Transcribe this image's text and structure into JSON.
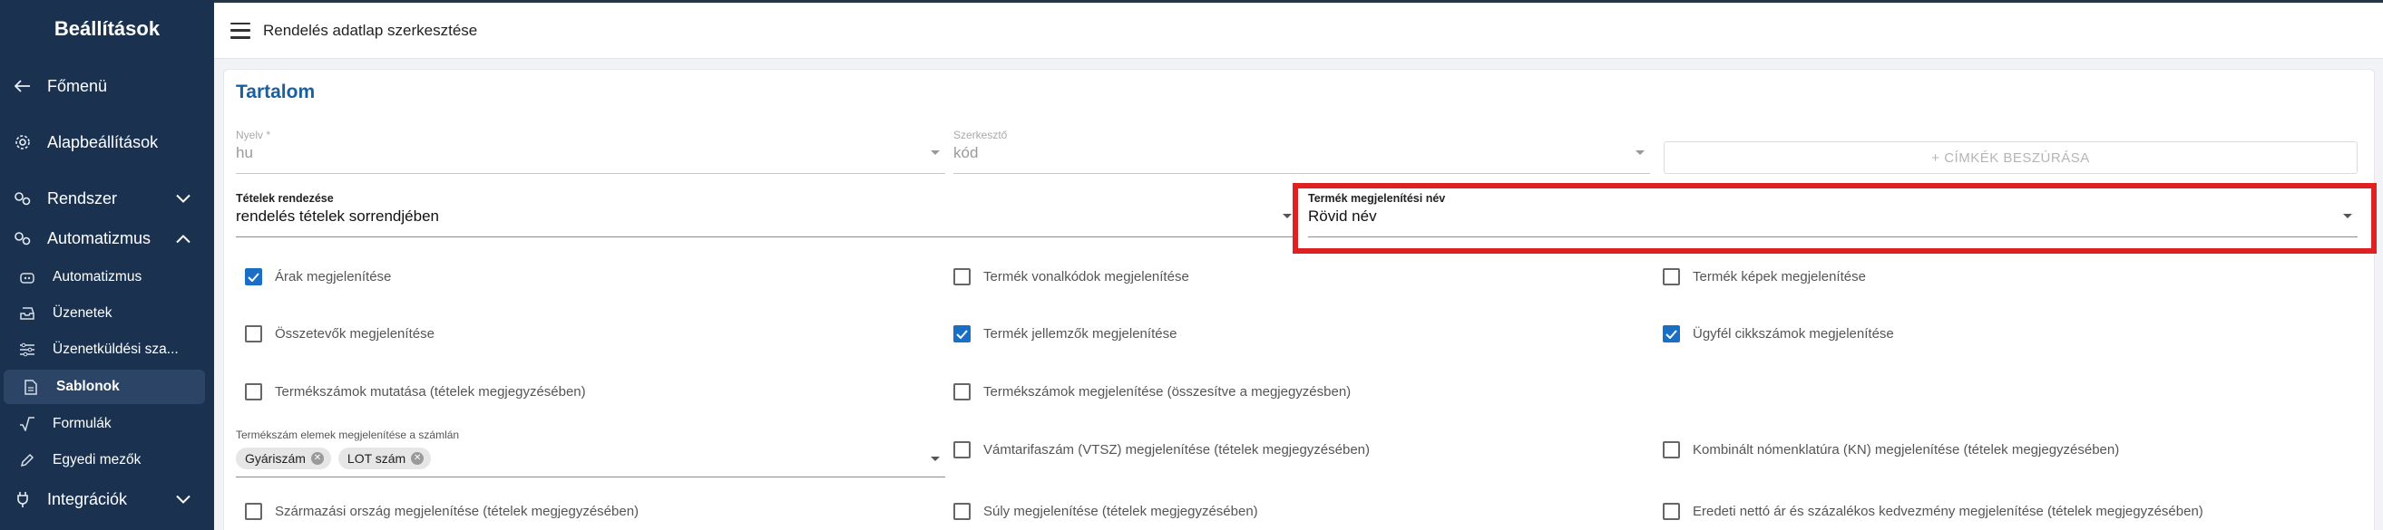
{
  "sidebar": {
    "title": "Beállítások",
    "items": [
      {
        "label": "Főmenü",
        "icon": "arrow-left-icon"
      },
      {
        "label": "Alapbeállítások",
        "icon": "gear-icon"
      },
      {
        "label": "Rendszer",
        "icon": "gears-icon"
      },
      {
        "label": "Automatizmus",
        "icon": "cogs-icon"
      }
    ],
    "subitems": [
      {
        "label": "Automatizmus",
        "icon": "robot-icon"
      },
      {
        "label": "Üzenetek",
        "icon": "inbox-icon"
      },
      {
        "label": "Üzenetküldési sza...",
        "icon": "sliders-icon"
      },
      {
        "label": "Sablonok",
        "icon": "document-icon",
        "active": true
      },
      {
        "label": "Formulák",
        "icon": "sqrt-icon"
      },
      {
        "label": "Egyedi mezők",
        "icon": "pencil-icon"
      }
    ],
    "bottom_item": {
      "label": "Integrációk",
      "icon": "plug-icon"
    }
  },
  "header": {
    "title": "Rendelés adatlap szerkesztése"
  },
  "card": {
    "title": "Tartalom",
    "language": {
      "label": "Nyelv *",
      "value": "hu"
    },
    "editor": {
      "label": "Szerkesztő",
      "value": "kód"
    },
    "insert_tags_label": "+ CÍMKÉK BESZÚRÁSA",
    "ordering": {
      "label": "Tételek rendezése",
      "value": "rendelés tételek sorrendjében"
    },
    "product_name": {
      "label": "Termék megjelenítési név",
      "value": "Rövid név"
    },
    "checkboxes": {
      "prices": {
        "label": "Árak megjelenítése",
        "checked": true
      },
      "barcodes": {
        "label": "Termék vonalkódok megjelenítése",
        "checked": false
      },
      "images": {
        "label": "Termék képek megjelenítése",
        "checked": false
      },
      "components": {
        "label": "Összetevők megjelenítése",
        "checked": false
      },
      "attributes": {
        "label": "Termék jellemzők megjelenítése",
        "checked": true
      },
      "customer_sku": {
        "label": "Ügyfél cikkszámok megjelenítése",
        "checked": true
      },
      "product_numbers_items": {
        "label": "Termékszámok mutatása (tételek megjegyzésében)",
        "checked": false
      },
      "product_numbers_summary": {
        "label": "Termékszámok megjelenítése (összesítve a megjegyzésben)",
        "checked": false
      },
      "vtsz": {
        "label": "Vámtarifaszám (VTSZ) megjelenítése (tételek megjegyzésében)",
        "checked": false
      },
      "kn": {
        "label": "Kombinált nómenklatúra (KN) megjelenítése (tételek megjegyzésében)",
        "checked": false
      },
      "origin": {
        "label": "Származási ország megjelenítése (tételek megjegyzésében)",
        "checked": false
      },
      "weight": {
        "label": "Súly megjelenítése (tételek megjegyzésében)",
        "checked": false
      },
      "original_price": {
        "label": "Eredeti nettó ár és százalékos kedvezmény megjelenítése (tételek megjegyzésében)",
        "checked": false
      }
    },
    "invoice_elements": {
      "label": "Termékszám elemek megjelenítése a számlán",
      "chips": [
        "Gyáriszám",
        "LOT szám"
      ]
    }
  }
}
